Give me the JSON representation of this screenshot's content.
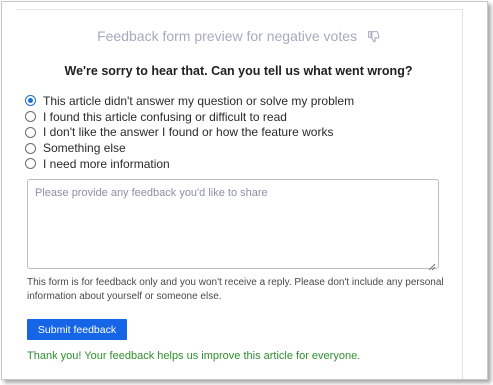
{
  "preview": {
    "title": "Feedback form preview for negative votes",
    "title_icon": "thumbs-down-icon"
  },
  "form": {
    "question": "We're sorry to hear that. Can you tell us what went wrong?",
    "options": [
      {
        "label": "This article didn't answer my question or solve my problem",
        "selected": true
      },
      {
        "label": "I found this article confusing or difficult to read",
        "selected": false
      },
      {
        "label": "I don't like the answer I found or how the feature works",
        "selected": false
      },
      {
        "label": "Something else",
        "selected": false
      },
      {
        "label": "I need more information",
        "selected": false
      }
    ],
    "feedback_placeholder": "Please provide any feedback you'd like to share",
    "disclaimer": "This form is for feedback only and you won't receive a reply. Please don't include any personal information about yourself or someone else.",
    "submit_label": "Submit feedback",
    "thanks_message": "Thank you! Your feedback helps us improve this article for everyone."
  },
  "colors": {
    "accent": "#1565e6",
    "title_muted": "#a7a9c0",
    "success": "#2f8f2f"
  }
}
